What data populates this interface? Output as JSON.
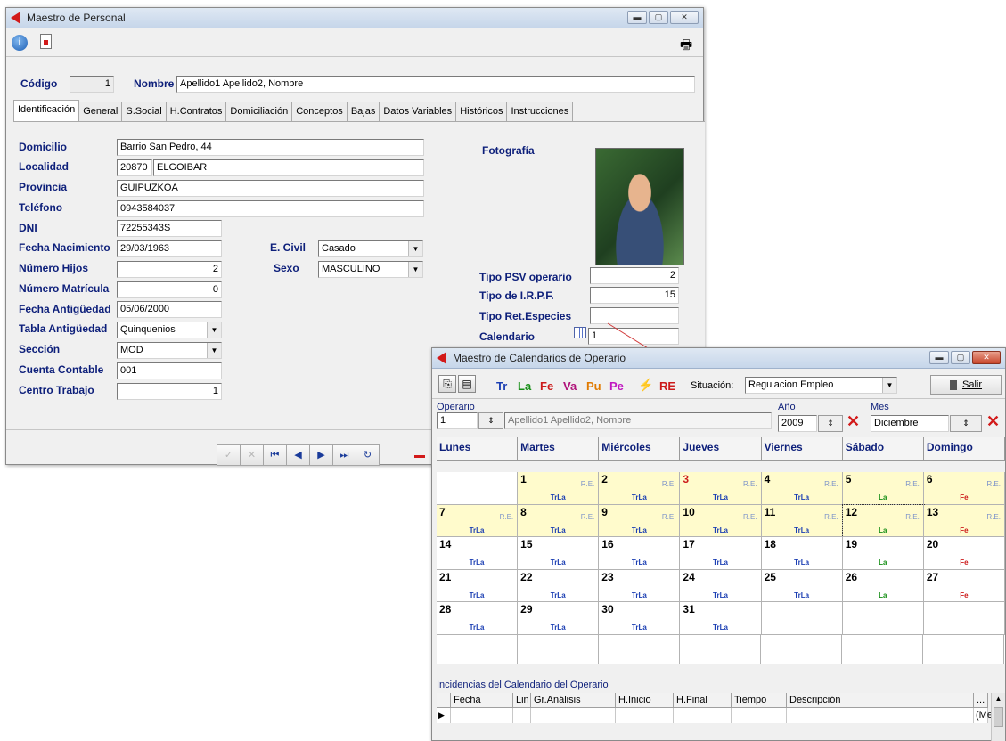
{
  "personal": {
    "title": "Maestro de Personal",
    "codigo_label": "Código",
    "codigo_value": "1",
    "nombre_label": "Nombre",
    "nombre_value": "Apellido1 Apellido2, Nombre",
    "tabs": [
      "Identificación",
      "General",
      "S.Social",
      "H.Contratos",
      "Domiciliación",
      "Conceptos",
      "Bajas",
      "Datos Variables",
      "Históricos",
      "Instrucciones"
    ],
    "fields": {
      "domicilio": {
        "label": "Domicilio",
        "value": "Barrio San Pedro, 44"
      },
      "localidad": {
        "label": "Localidad",
        "cp": "20870",
        "value": "ELGOIBAR"
      },
      "provincia": {
        "label": "Provincia",
        "value": "GUIPUZKOA"
      },
      "telefono": {
        "label": "Teléfono",
        "value": "0943584037"
      },
      "dni": {
        "label": "DNI",
        "value": "72255343S"
      },
      "fecha_nacimiento": {
        "label": "Fecha Nacimiento",
        "value": "29/03/1963"
      },
      "numero_hijos": {
        "label": "Número Hijos",
        "value": "2"
      },
      "numero_matricula": {
        "label": "Número Matrícula",
        "value": "0"
      },
      "fecha_antiguedad": {
        "label": "Fecha Antigüedad",
        "value": "05/06/2000"
      },
      "tabla_antiguedad": {
        "label": "Tabla Antigüedad",
        "value": "Quinquenios"
      },
      "seccion": {
        "label": "Sección",
        "value": "MOD"
      },
      "cuenta_contable": {
        "label": "Cuenta Contable",
        "value": "001"
      },
      "centro_trabajo": {
        "label": "Centro Trabajo",
        "value": "1"
      },
      "estado_civil": {
        "label": "E. Civil",
        "value": "Casado"
      },
      "sexo": {
        "label": "Sexo",
        "value": "MASCULINO"
      },
      "fotografia_label": "Fotografía",
      "tipo_psv": {
        "label": "Tipo PSV operario",
        "value": "2"
      },
      "tipo_irpf": {
        "label": "Tipo de I.R.P.F.",
        "value": "15"
      },
      "tipo_ret": {
        "label": "Tipo Ret.Especies",
        "value": ""
      },
      "calendario": {
        "label": "Calendario",
        "value": "1"
      }
    }
  },
  "calendar": {
    "title": "Maestro de Calendarios de Operario",
    "codes": [
      {
        "text": "Tr",
        "color": "#1c3fb3"
      },
      {
        "text": "La",
        "color": "#178f17"
      },
      {
        "text": "Fe",
        "color": "#cc1a1a"
      },
      {
        "text": "Va",
        "color": "#b0127a"
      },
      {
        "text": "Pu",
        "color": "#e07a00"
      },
      {
        "text": "Pe",
        "color": "#c018c0"
      }
    ],
    "re_label": "RE",
    "situacion_label": "Situación:",
    "situacion_value": "Regulacion Empleo",
    "salir_label": "Salir",
    "operario_label": "Operario",
    "operario_value": "1",
    "operario_name": "Apellido1 Apellido2, Nombre",
    "anio_label": "Año",
    "anio_value": "2009",
    "mes_label": "Mes",
    "mes_value": "Diciembre",
    "weekdays": [
      "Lunes",
      "Martes",
      "Miércoles",
      "Jueves",
      "Viernes",
      "Sábado",
      "Domingo"
    ],
    "re_cell": "R.E.",
    "days": [
      {
        "n": "",
        "codes": ""
      },
      {
        "n": "1",
        "codes": "TrLa",
        "re": true,
        "yel": true
      },
      {
        "n": "2",
        "codes": "TrLa",
        "re": true,
        "yel": true
      },
      {
        "n": "3",
        "codes": "TrLa",
        "re": true,
        "yel": true,
        "red": true
      },
      {
        "n": "4",
        "codes": "TrLa",
        "re": true,
        "yel": true
      },
      {
        "n": "5",
        "codes": "La",
        "re": true,
        "yel": true
      },
      {
        "n": "6",
        "codes": "Fe",
        "re": true,
        "yel": true
      },
      {
        "n": "7",
        "codes": "TrLa",
        "re": true,
        "yel": true
      },
      {
        "n": "8",
        "codes": "TrLa",
        "re": true,
        "yel": true
      },
      {
        "n": "9",
        "codes": "TrLa",
        "re": true,
        "yel": true
      },
      {
        "n": "10",
        "codes": "TrLa",
        "re": true,
        "yel": true
      },
      {
        "n": "11",
        "codes": "TrLa",
        "re": true,
        "yel": true
      },
      {
        "n": "12",
        "codes": "La",
        "re": true,
        "yel": true,
        "sel": true
      },
      {
        "n": "13",
        "codes": "Fe",
        "re": true,
        "yel": true
      },
      {
        "n": "14",
        "codes": "TrLa"
      },
      {
        "n": "15",
        "codes": "TrLa"
      },
      {
        "n": "16",
        "codes": "TrLa"
      },
      {
        "n": "17",
        "codes": "TrLa"
      },
      {
        "n": "18",
        "codes": "TrLa"
      },
      {
        "n": "19",
        "codes": "La"
      },
      {
        "n": "20",
        "codes": "Fe"
      },
      {
        "n": "21",
        "codes": "TrLa"
      },
      {
        "n": "22",
        "codes": "TrLa"
      },
      {
        "n": "23",
        "codes": "TrLa"
      },
      {
        "n": "24",
        "codes": "TrLa"
      },
      {
        "n": "25",
        "codes": "TrLa"
      },
      {
        "n": "26",
        "codes": "La"
      },
      {
        "n": "27",
        "codes": "Fe"
      },
      {
        "n": "28",
        "codes": "TrLa"
      },
      {
        "n": "29",
        "codes": "TrLa"
      },
      {
        "n": "30",
        "codes": "TrLa"
      },
      {
        "n": "31",
        "codes": "TrLa"
      },
      {
        "n": "",
        "codes": ""
      },
      {
        "n": "",
        "codes": ""
      },
      {
        "n": "",
        "codes": ""
      }
    ],
    "incidencias_label": "Incidencias del Calendario del Operario",
    "incidencias_columns": [
      "Fecha",
      "Lin",
      "Gr.Análisis",
      "H.Inicio",
      "H.Final",
      "Tiempo",
      "Descripción",
      "..."
    ],
    "memo_text": "(Me"
  }
}
